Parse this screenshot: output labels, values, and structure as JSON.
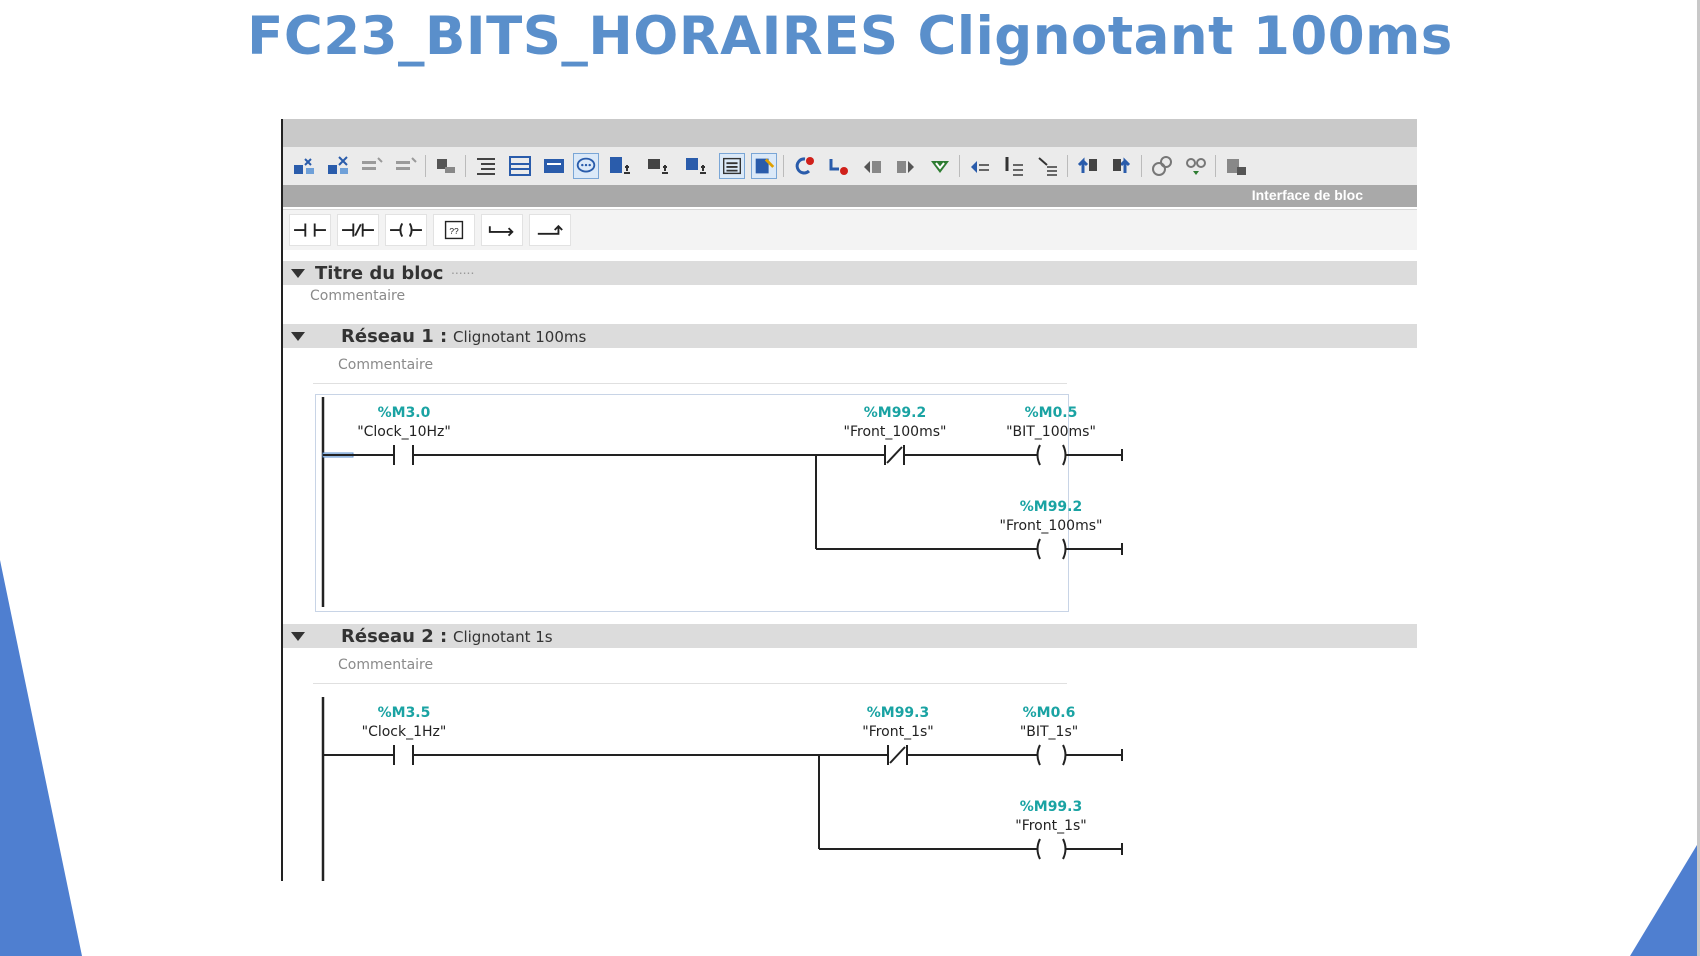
{
  "slide": {
    "title": "FC23_BITS_HORAIRES Clignotant 100ms"
  },
  "editor": {
    "interface_label": "Interface de bloc",
    "block": {
      "title": "Titre du bloc",
      "title_dots": "......",
      "comment": "Commentaire"
    },
    "networks": [
      {
        "label": "Réseau 1 :",
        "title": "Clignotant 100ms",
        "comment": "Commentaire",
        "input": {
          "address": "%M3.0",
          "symbol": "\"Clock_10Hz\""
        },
        "branch_contact": {
          "address": "%M99.2",
          "symbol": "\"Front_100ms\"",
          "type": "normally-closed"
        },
        "coil_top": {
          "address": "%M0.5",
          "symbol": "\"BIT_100ms\""
        },
        "coil_bottom": {
          "address": "%M99.2",
          "symbol": "\"Front_100ms\""
        }
      },
      {
        "label": "Réseau 2 :",
        "title": "Clignotant 1s",
        "comment": "Commentaire",
        "input": {
          "address": "%M3.5",
          "symbol": "\"Clock_1Hz\""
        },
        "branch_contact": {
          "address": "%M99.3",
          "symbol": "\"Front_1s\"",
          "type": "normally-closed"
        },
        "coil_top": {
          "address": "%M0.6",
          "symbol": "\"BIT_1s\""
        },
        "coil_bottom": {
          "address": "%M99.3",
          "symbol": "\"Front_1s\""
        }
      }
    ]
  },
  "colors": {
    "title": "#5a8fcb",
    "address": "#1aa3a3",
    "deco": "#4f7fd0"
  },
  "icons": {
    "toolbar": [
      "insert-network-icon",
      "delete-network-icon",
      "insert-row-icon",
      "insert-row-2-icon",
      "block-call-icon",
      "show-all-icon",
      "show-networks-icon",
      "show-comments-icon",
      "comment-icon",
      "expand-icon",
      "abs-operands-icon",
      "favorites-icon",
      "line-list-icon",
      "show-favorites-icon",
      "go-first-error-icon",
      "go-next-error-icon",
      "previous-network-icon",
      "next-network-icon",
      "update-calls-icon",
      "monitor-off-icon",
      "monitor-on-icon",
      "jump-back-icon",
      "jump-forward-icon",
      "diff-icon",
      "snapshot-icon",
      "compare-icon",
      "lock-icon"
    ],
    "ladder": [
      "no-contact-icon",
      "nc-contact-icon",
      "coil-icon",
      "empty-box-icon",
      "open-branch-icon",
      "close-branch-icon"
    ]
  }
}
